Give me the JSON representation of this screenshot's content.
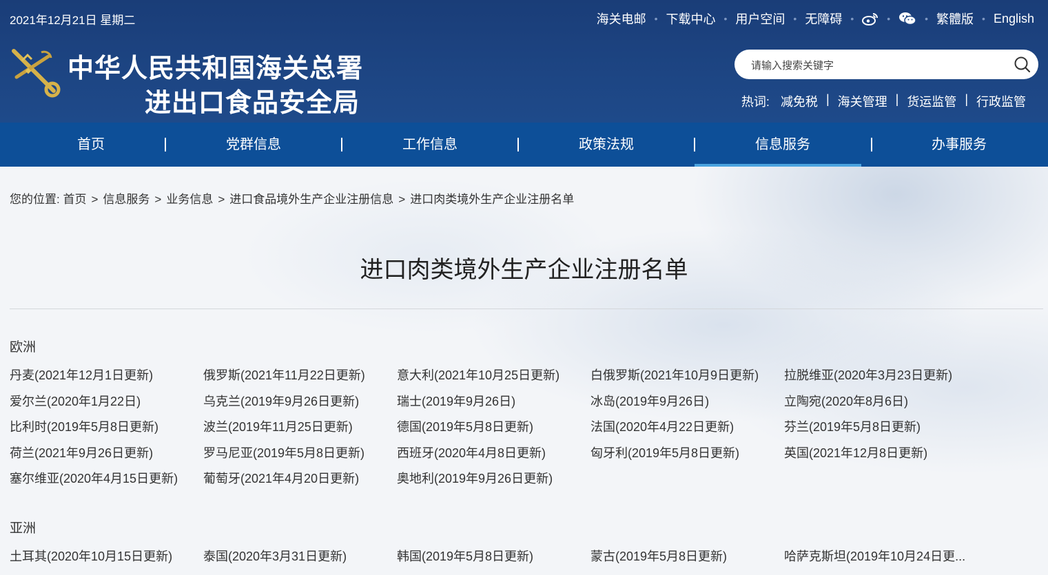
{
  "header": {
    "date": "2021年12月21日 星期二",
    "top_links": [
      "海关电邮",
      "下载中心",
      "用户空间",
      "无障碍",
      "繁體版",
      "English"
    ],
    "title_line1": "中华人民共和国海关总署",
    "title_line2": "进出口食品安全局",
    "search_placeholder": "请输入搜索关键字",
    "hot_label": "热词:",
    "hot_words": [
      "减免税",
      "海关管理",
      "货运监管",
      "行政监管"
    ]
  },
  "nav": {
    "items": [
      "首页",
      "党群信息",
      "工作信息",
      "政策法规",
      "信息服务",
      "办事服务"
    ],
    "active": "信息服务"
  },
  "breadcrumb": {
    "prefix": "您的位置:",
    "items": [
      "首页",
      "信息服务",
      "业务信息",
      "进口食品境外生产企业注册信息",
      "进口肉类境外生产企业注册名单"
    ]
  },
  "page_title": "进口肉类境外生产企业注册名单",
  "sections": [
    {
      "title": "欧洲",
      "entries": [
        "丹麦(2021年12月1日更新)",
        "俄罗斯(2021年11月22日更新)",
        "意大利(2021年10月25日更新)",
        "白俄罗斯(2021年10月9日更新)",
        "拉脱维亚(2020年3月23日更新)",
        "爱尔兰(2020年1月22日)",
        "乌克兰(2019年9月26日更新)",
        "瑞士(2019年9月26日)",
        "冰岛(2019年9月26日)",
        "立陶宛(2020年8月6日)",
        "比利时(2019年5月8日更新)",
        "波兰(2019年11月25日更新)",
        "德国(2019年5月8日更新)",
        "法国(2020年4月22日更新)",
        "芬兰(2019年5月8日更新)",
        "荷兰(2021年9月26日更新)",
        "罗马尼亚(2019年5月8日更新)",
        "西班牙(2020年4月8日更新)",
        "匈牙利(2019年5月8日更新)",
        "英国(2021年12月8日更新)",
        "塞尔维亚(2020年4月15日更新)",
        "葡萄牙(2021年4月20日更新)",
        "奥地利(2019年9月26日更新)"
      ]
    },
    {
      "title": "亚洲",
      "entries": [
        "土耳其(2020年10月15日更新)",
        "泰国(2020年3月31日更新)",
        "韩国(2019年5月8日更新)",
        "蒙古(2019年5月8日更新)",
        "哈萨克斯坦(2019年10月24日更..."
      ]
    }
  ]
}
